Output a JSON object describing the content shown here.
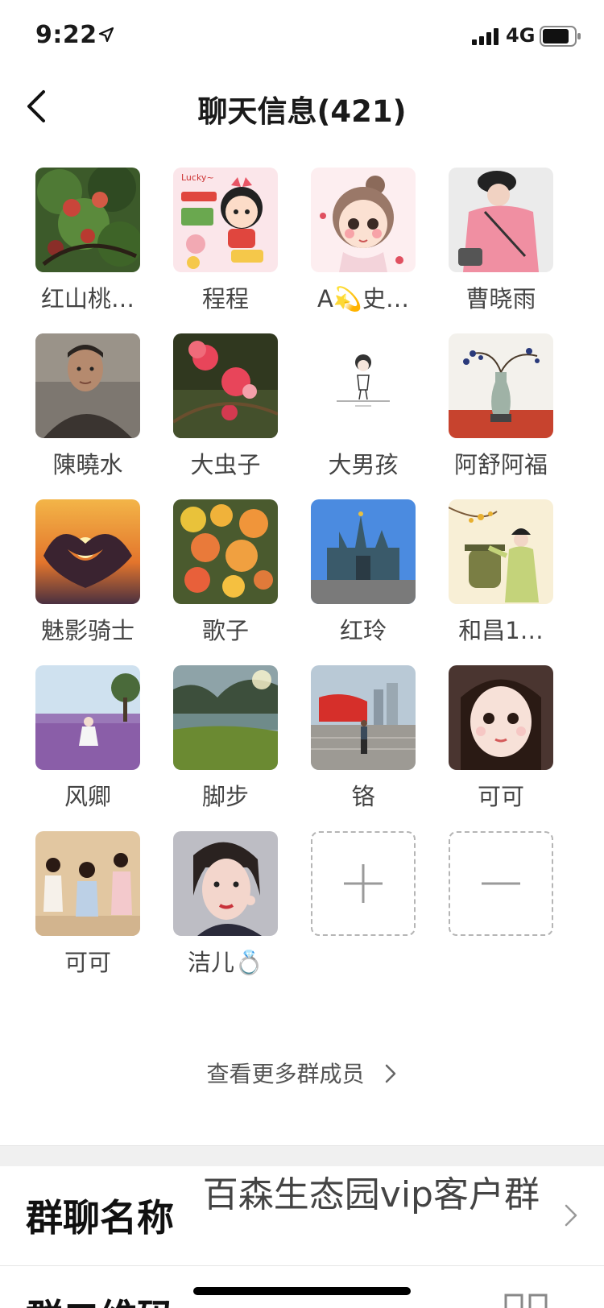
{
  "status_bar": {
    "time": "9:22",
    "network": "4G",
    "icons": [
      "location-arrow-icon",
      "signal-bars-icon",
      "battery-icon"
    ]
  },
  "nav": {
    "title": "聊天信息(421)",
    "back_icon": "chevron-left-icon"
  },
  "members": [
    {
      "name": "红山桃…",
      "avatar": "peach-tree-photo"
    },
    {
      "name": "程程",
      "avatar": "cartoon-girl-sticker"
    },
    {
      "name": "A💫史…",
      "avatar": "cartoon-girl-drawing"
    },
    {
      "name": "曹晓雨",
      "avatar": "pink-hoodie-photo"
    },
    {
      "name": "陳曉水",
      "avatar": "man-portrait-photo"
    },
    {
      "name": "大虫子",
      "avatar": "red-blossom-photo"
    },
    {
      "name": "大男孩",
      "avatar": "sketch-figure"
    },
    {
      "name": "阿舒阿福",
      "avatar": "vase-still-life"
    },
    {
      "name": "魅影骑士",
      "avatar": "heart-hands-sunset"
    },
    {
      "name": "歌子",
      "avatar": "autumn-leaves-photo"
    },
    {
      "name": "红玲",
      "avatar": "castle-photo"
    },
    {
      "name": "和昌1…",
      "avatar": "traditional-painting"
    },
    {
      "name": "风卿",
      "avatar": "lavender-field-photo"
    },
    {
      "name": "脚步",
      "avatar": "mountain-lake-photo"
    },
    {
      "name": "铬",
      "avatar": "plaza-photo"
    },
    {
      "name": "可可",
      "avatar": "girl-selfie-photo"
    },
    {
      "name": "可可",
      "avatar": "three-children-photo"
    },
    {
      "name": "洁儿💍",
      "avatar": "woman-portrait-photo"
    }
  ],
  "actions": {
    "add_icon": "plus-icon",
    "remove_icon": "minus-icon"
  },
  "more_members": {
    "label": "查看更多群成员",
    "icon": "chevron-right-icon"
  },
  "group_name": {
    "label": "群聊名称",
    "value": "百森生态园vip客户群"
  },
  "qr_code": {
    "label": "群二维码",
    "icon": "qr-code-icon"
  },
  "colors": {
    "divider_bg": "#f0f0f0",
    "dashed_border": "#b5b5b5",
    "secondary_text": "#555555"
  }
}
